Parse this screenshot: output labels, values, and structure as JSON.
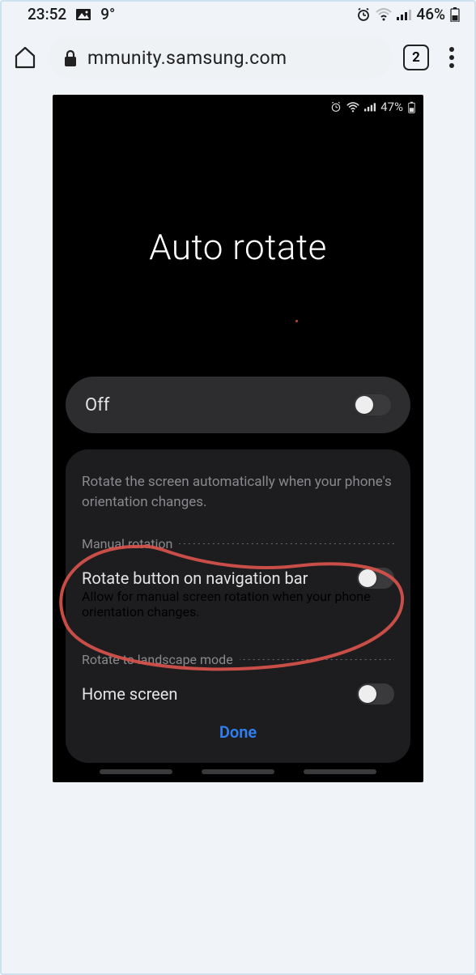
{
  "outer_status": {
    "time": "23:52",
    "temp": "9°",
    "battery": "46%"
  },
  "browser": {
    "url": "mmunity.samsung.com",
    "tabs": "2"
  },
  "inner_status": {
    "battery": "47%"
  },
  "hero": {
    "title": "Auto rotate"
  },
  "off": {
    "label": "Off"
  },
  "panel": {
    "description": "Rotate the screen automatically when your phone's orientation changes.",
    "section1": "Manual rotation",
    "row1_title": "Rotate button on navigation bar",
    "row1_sub": "Allow for manual screen rotation when your phone orientation changes.",
    "section2": "Rotate to landscape mode",
    "row2_title": "Home screen",
    "done": "Done"
  }
}
